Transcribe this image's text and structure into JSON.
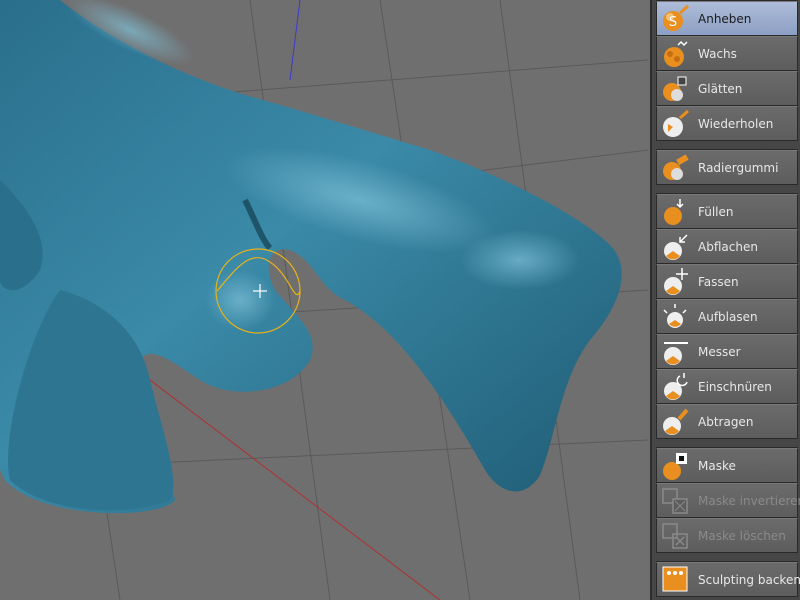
{
  "colors": {
    "accent_active": "#9aabcf",
    "sculpt_surface": "#2f7a97",
    "brush_ring": "#e6b21a",
    "icon_orange": "#e88f1f"
  },
  "viewport": {
    "brush_cursor_icon": "crosshair-icon"
  },
  "tools": {
    "groups": [
      {
        "items": [
          {
            "label": "Anheben",
            "icon": "pull-brush-icon",
            "state": "active"
          },
          {
            "label": "Wachs",
            "icon": "wax-brush-icon",
            "state": "normal"
          },
          {
            "label": "Glätten",
            "icon": "smooth-brush-icon",
            "state": "normal"
          },
          {
            "label": "Wiederholen",
            "icon": "repeat-brush-icon",
            "state": "normal"
          }
        ]
      },
      {
        "items": [
          {
            "label": "Radiergummi",
            "icon": "eraser-brush-icon",
            "state": "normal"
          }
        ]
      },
      {
        "items": [
          {
            "label": "Füllen",
            "icon": "fill-brush-icon",
            "state": "normal"
          },
          {
            "label": "Abflachen",
            "icon": "flatten-brush-icon",
            "state": "normal"
          },
          {
            "label": "Fassen",
            "icon": "grab-brush-icon",
            "state": "normal"
          },
          {
            "label": "Aufblasen",
            "icon": "inflate-brush-icon",
            "state": "normal"
          },
          {
            "label": "Messer",
            "icon": "knife-brush-icon",
            "state": "normal"
          },
          {
            "label": "Einschnüren",
            "icon": "pinch-brush-icon",
            "state": "normal"
          },
          {
            "label": "Abtragen",
            "icon": "scrape-brush-icon",
            "state": "normal"
          }
        ]
      },
      {
        "items": [
          {
            "label": "Maske",
            "icon": "mask-icon",
            "state": "normal"
          },
          {
            "label": "Maske invertieren",
            "icon": "mask-invert-icon",
            "state": "disabled"
          },
          {
            "label": "Maske löschen",
            "icon": "mask-clear-icon",
            "state": "disabled"
          }
        ]
      },
      {
        "items": [
          {
            "label": "Sculpting backen",
            "icon": "bake-sculpt-icon",
            "state": "normal"
          }
        ]
      }
    ]
  }
}
